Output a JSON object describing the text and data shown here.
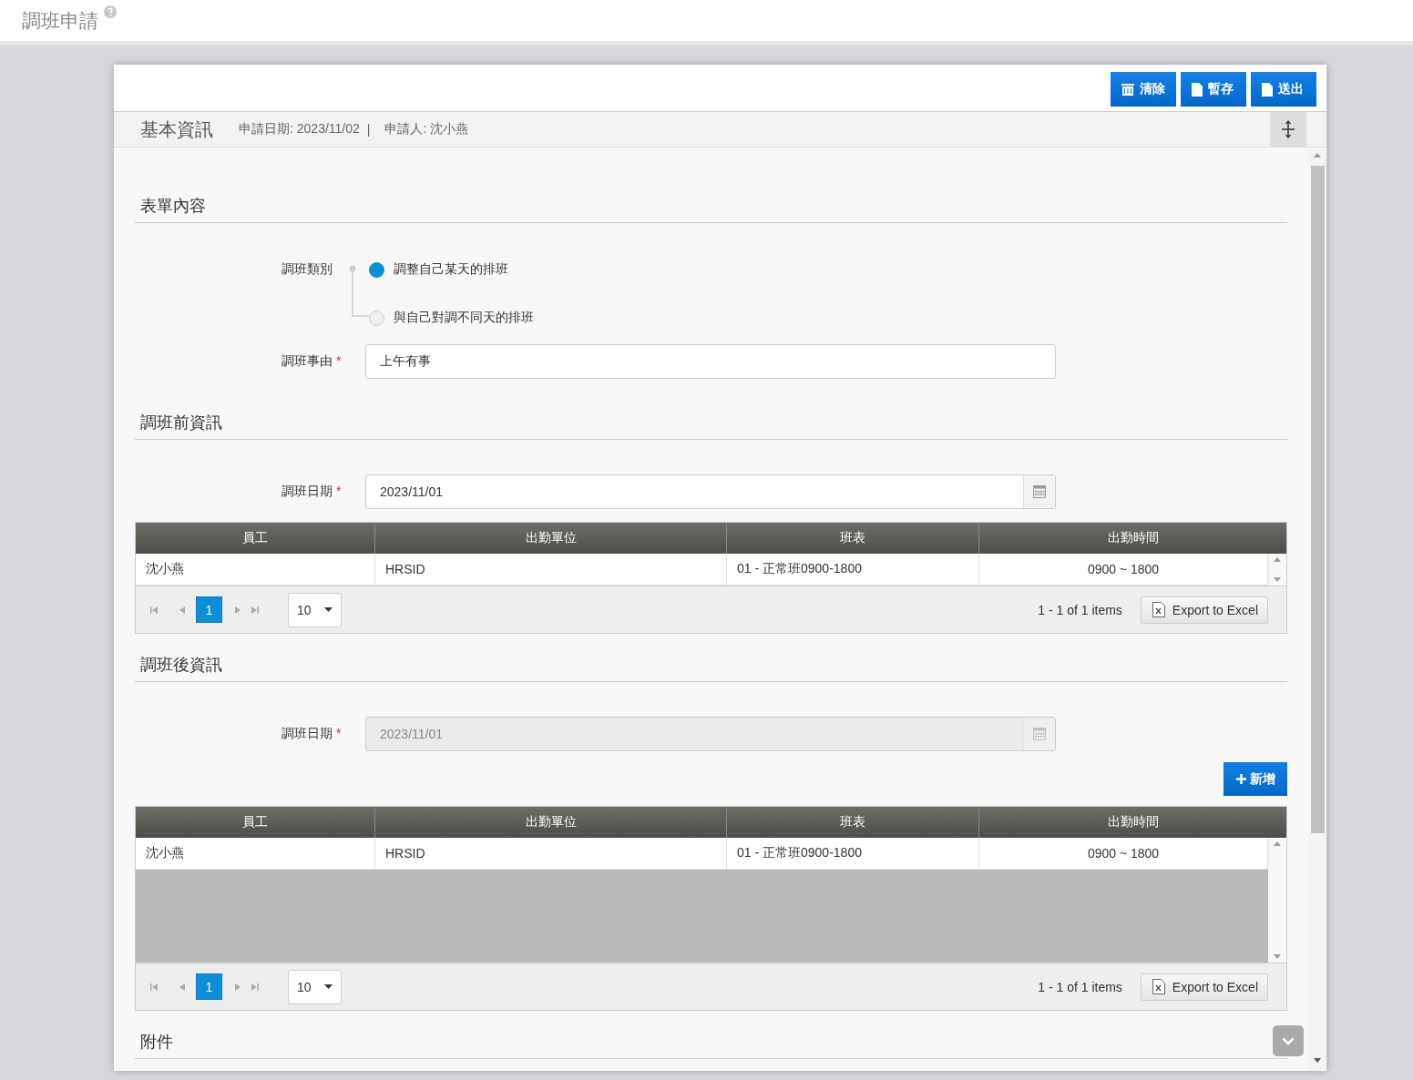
{
  "page_title": "調班申請",
  "toolbar": [
    {
      "label": "清除"
    },
    {
      "label": "暫存"
    },
    {
      "label": "送出"
    }
  ],
  "info_bar": {
    "title": "基本資訊",
    "date": "申請日期: 2023/11/02",
    "separator": "|",
    "applicant": "申請人: 沈小燕"
  },
  "sections": [
    {
      "title": "表單內容",
      "fields": [
        {
          "kind": "radio",
          "label": "調班類別",
          "options": [
            {
              "label": "調整自己某天的排班",
              "selected": true
            },
            {
              "label": "與自己對調不同天的排班",
              "selected": false
            }
          ]
        },
        {
          "kind": "text",
          "label": "調班事由",
          "required_mark": "*",
          "value": "上午有事"
        }
      ]
    },
    {
      "title": "調班前資訊",
      "fields": [
        {
          "kind": "date",
          "label": "調班日期",
          "required_mark": "*",
          "value": "2023/11/01",
          "disabled": false
        }
      ],
      "grid": {
        "kind": "compact",
        "columns": [
          "員工",
          "出勤單位",
          "班表",
          "出勤時間"
        ],
        "rows": [
          [
            "沈小燕",
            "HRSID",
            "01 - 正常班0900-1800",
            "0900 ~ 1800"
          ]
        ],
        "pages": [
          {
            "label": "1",
            "selected": true
          }
        ],
        "page_size": "10",
        "summary": "1 - 1 of 1 items",
        "export": "Export to Excel"
      }
    },
    {
      "title": "調班後資訊",
      "fields": [
        {
          "kind": "date",
          "label": "調班日期",
          "required_mark": "*",
          "value": "2023/11/01",
          "disabled": true
        }
      ],
      "add_button": "新增",
      "grid": {
        "kind": "scrolling",
        "columns": [
          "員工",
          "出勤單位",
          "班表",
          "出勤時間"
        ],
        "rows": [
          [
            "沈小燕",
            "HRSID",
            "01 - 正常班0900-1800",
            "0900 ~ 1800"
          ]
        ],
        "pages": [
          {
            "label": "1",
            "selected": true
          }
        ],
        "page_size": "10",
        "summary": "1 - 1 of 1 items",
        "export": "Export to Excel"
      }
    },
    {
      "title": "附件"
    }
  ]
}
